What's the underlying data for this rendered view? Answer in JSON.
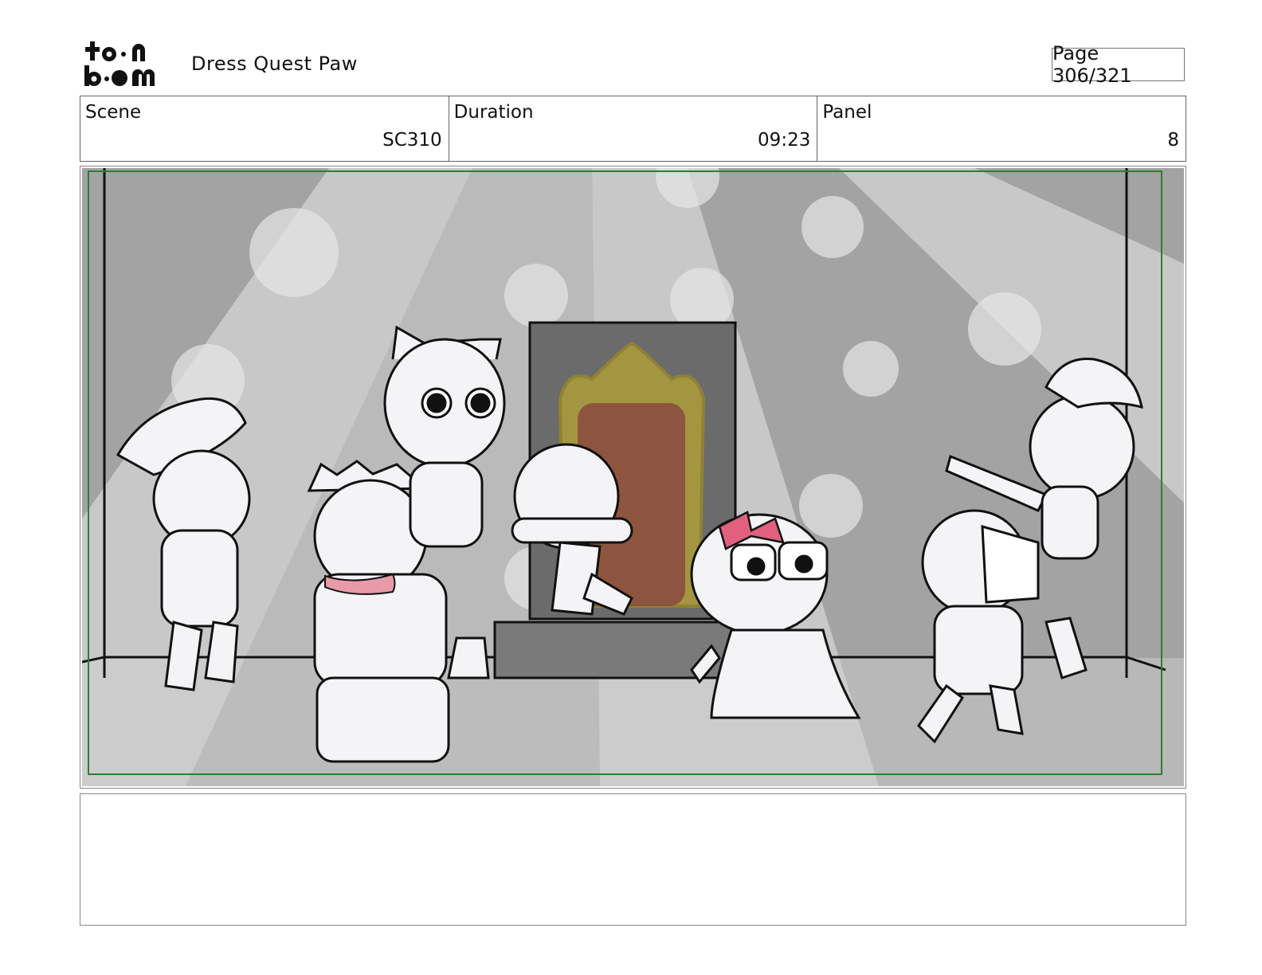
{
  "header": {
    "logo_text": "toon boom",
    "project_title": "Dress Quest Paw",
    "page_label": "Page 306/321"
  },
  "info": {
    "scene_label": "Scene",
    "scene_value": "SC310",
    "duration_label": "Duration",
    "duration_value": "09:23",
    "panel_label": "Panel",
    "panel_value": "8"
  },
  "notes": {
    "text": ""
  },
  "colors": {
    "safe_frame": "#2e7d32",
    "bow_pink": "#e0607e",
    "mirror_gold": "#b8a532",
    "mirror_red": "#8a4a40"
  }
}
